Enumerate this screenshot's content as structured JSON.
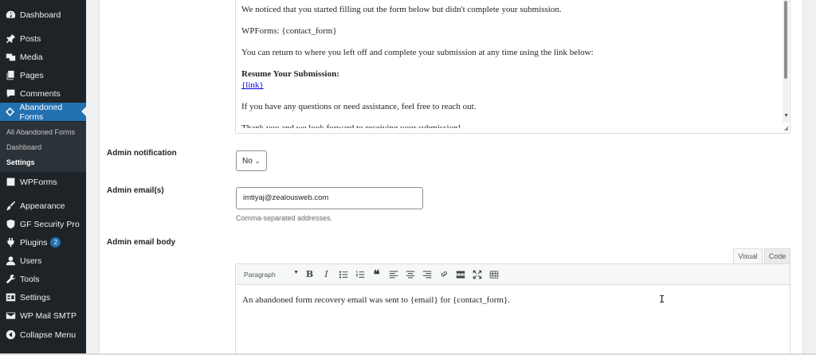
{
  "sidebar": {
    "items": [
      {
        "label": "Dashboard",
        "icon": "dashboard-icon"
      },
      {
        "label": "Posts",
        "icon": "pin-icon"
      },
      {
        "label": "Media",
        "icon": "media-icon"
      },
      {
        "label": "Pages",
        "icon": "pages-icon"
      },
      {
        "label": "Comments",
        "icon": "comments-icon"
      },
      {
        "label": "Abandoned Forms",
        "icon": "abandoned-forms-icon"
      },
      {
        "label": "WPForms",
        "icon": "wpforms-icon"
      },
      {
        "label": "Appearance",
        "icon": "brush-icon"
      },
      {
        "label": "GF Security Pro",
        "icon": "shield-icon"
      },
      {
        "label": "Plugins",
        "icon": "plugin-icon",
        "badge": "2"
      },
      {
        "label": "Users",
        "icon": "users-icon"
      },
      {
        "label": "Tools",
        "icon": "wrench-icon"
      },
      {
        "label": "Settings",
        "icon": "settings-icon"
      },
      {
        "label": "WP Mail SMTP",
        "icon": "mail-icon"
      },
      {
        "label": "Collapse Menu",
        "icon": "collapse-icon"
      }
    ],
    "submenu": [
      "All Abandoned Forms",
      "Dashboard",
      "Settings"
    ]
  },
  "top_editor": {
    "p1": "We noticed that you started filling out the form below but didn't complete your submission.",
    "p2": "WPForms: {contact_form}",
    "p3": "You can return to where you left off and complete your submission at any time using the link below:",
    "resume_heading": "Resume Your Submission:",
    "link_text": "{link}",
    "p5": "If you have any questions or need assistance, feel free to reach out.",
    "p6_cut": "Thank you and we look forward to receiving your submission!"
  },
  "admin_notification": {
    "label": "Admin notification",
    "value": "No"
  },
  "admin_emails": {
    "label": "Admin email(s)",
    "value": "imtiyaj@zealousweb.com",
    "description": "Comma-separated addresses."
  },
  "admin_email_body": {
    "label": "Admin email body",
    "tab_visual": "Visual",
    "tab_code": "Code",
    "format": "Paragraph",
    "content": "An abandoned form recovery email was sent to {email} for {contact_form}."
  },
  "colors": {
    "sidebar_bg": "#1d2327",
    "active_bg": "#2271b1",
    "link": "#0000ee"
  }
}
